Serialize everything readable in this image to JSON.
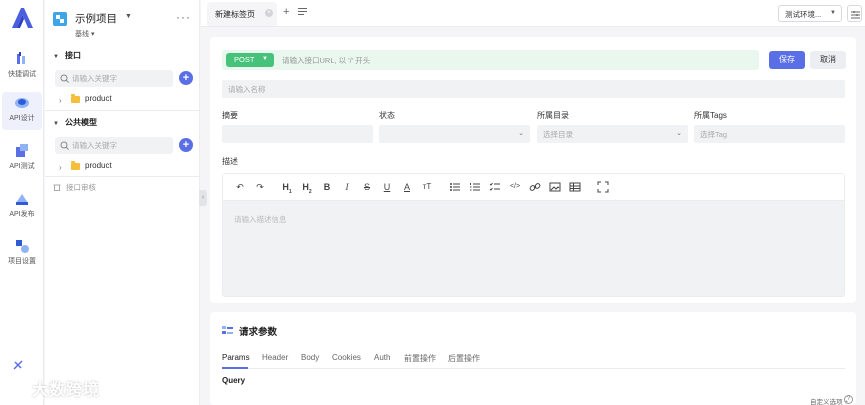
{
  "rail": {
    "items": [
      {
        "label": "快捷调试",
        "icon": "quick-debug-icon"
      },
      {
        "label": "API设计",
        "icon": "api-design-icon",
        "active": true
      },
      {
        "label": "API测试",
        "icon": "api-test-icon"
      },
      {
        "label": "API发布",
        "icon": "api-publish-icon"
      },
      {
        "label": "项目设置",
        "icon": "project-settings-icon"
      }
    ]
  },
  "sidebar": {
    "project_name": "示例项目",
    "branch": "基线",
    "more": "···",
    "sections": [
      {
        "title": "接口",
        "search_placeholder": "请输入关键字",
        "items": [
          "product"
        ]
      },
      {
        "title": "公共模型",
        "search_placeholder": "请输入关键字",
        "items": [
          "product"
        ]
      }
    ],
    "recycle": "接口审核"
  },
  "tabs": {
    "items": [
      {
        "label": "新建标签页"
      }
    ],
    "add": "+",
    "env_label": "测试环境..."
  },
  "editor": {
    "method": "POST",
    "url_placeholder": "请输入接口URL, 以 '/' 开头",
    "save": "保存",
    "cancel": "取消",
    "name_placeholder": "请输入名称",
    "fields": [
      {
        "label": "摘要",
        "placeholder": ""
      },
      {
        "label": "状态",
        "placeholder": ""
      },
      {
        "label": "所属目录",
        "placeholder": "选择目录"
      },
      {
        "label": "所属Tags",
        "placeholder": "选择Tag"
      }
    ],
    "desc_label": "描述",
    "desc_placeholder": "请输入描述信息",
    "toolbar": [
      "↶",
      "↷",
      "H1",
      "H2",
      "B",
      "I",
      "S",
      "U",
      "A",
      "T",
      "list-ul",
      "list-ol",
      "list-check",
      "code",
      "link",
      "image",
      "table",
      "fullscreen"
    ]
  },
  "request": {
    "title": "请求参数",
    "tabs": [
      "Params",
      "Header",
      "Body",
      "Cookies",
      "Auth",
      "前置操作",
      "后置操作"
    ],
    "active_tab": "Params",
    "section": "Query"
  },
  "watermark": "大数跨境",
  "footer": {
    "custom_options": "自定义选项 +",
    "help": "?"
  },
  "colors": {
    "accent": "#5a6fe6",
    "method_post": "#47c27a",
    "url_bg": "#eaf7ee",
    "folder": "#f4bf3a"
  }
}
